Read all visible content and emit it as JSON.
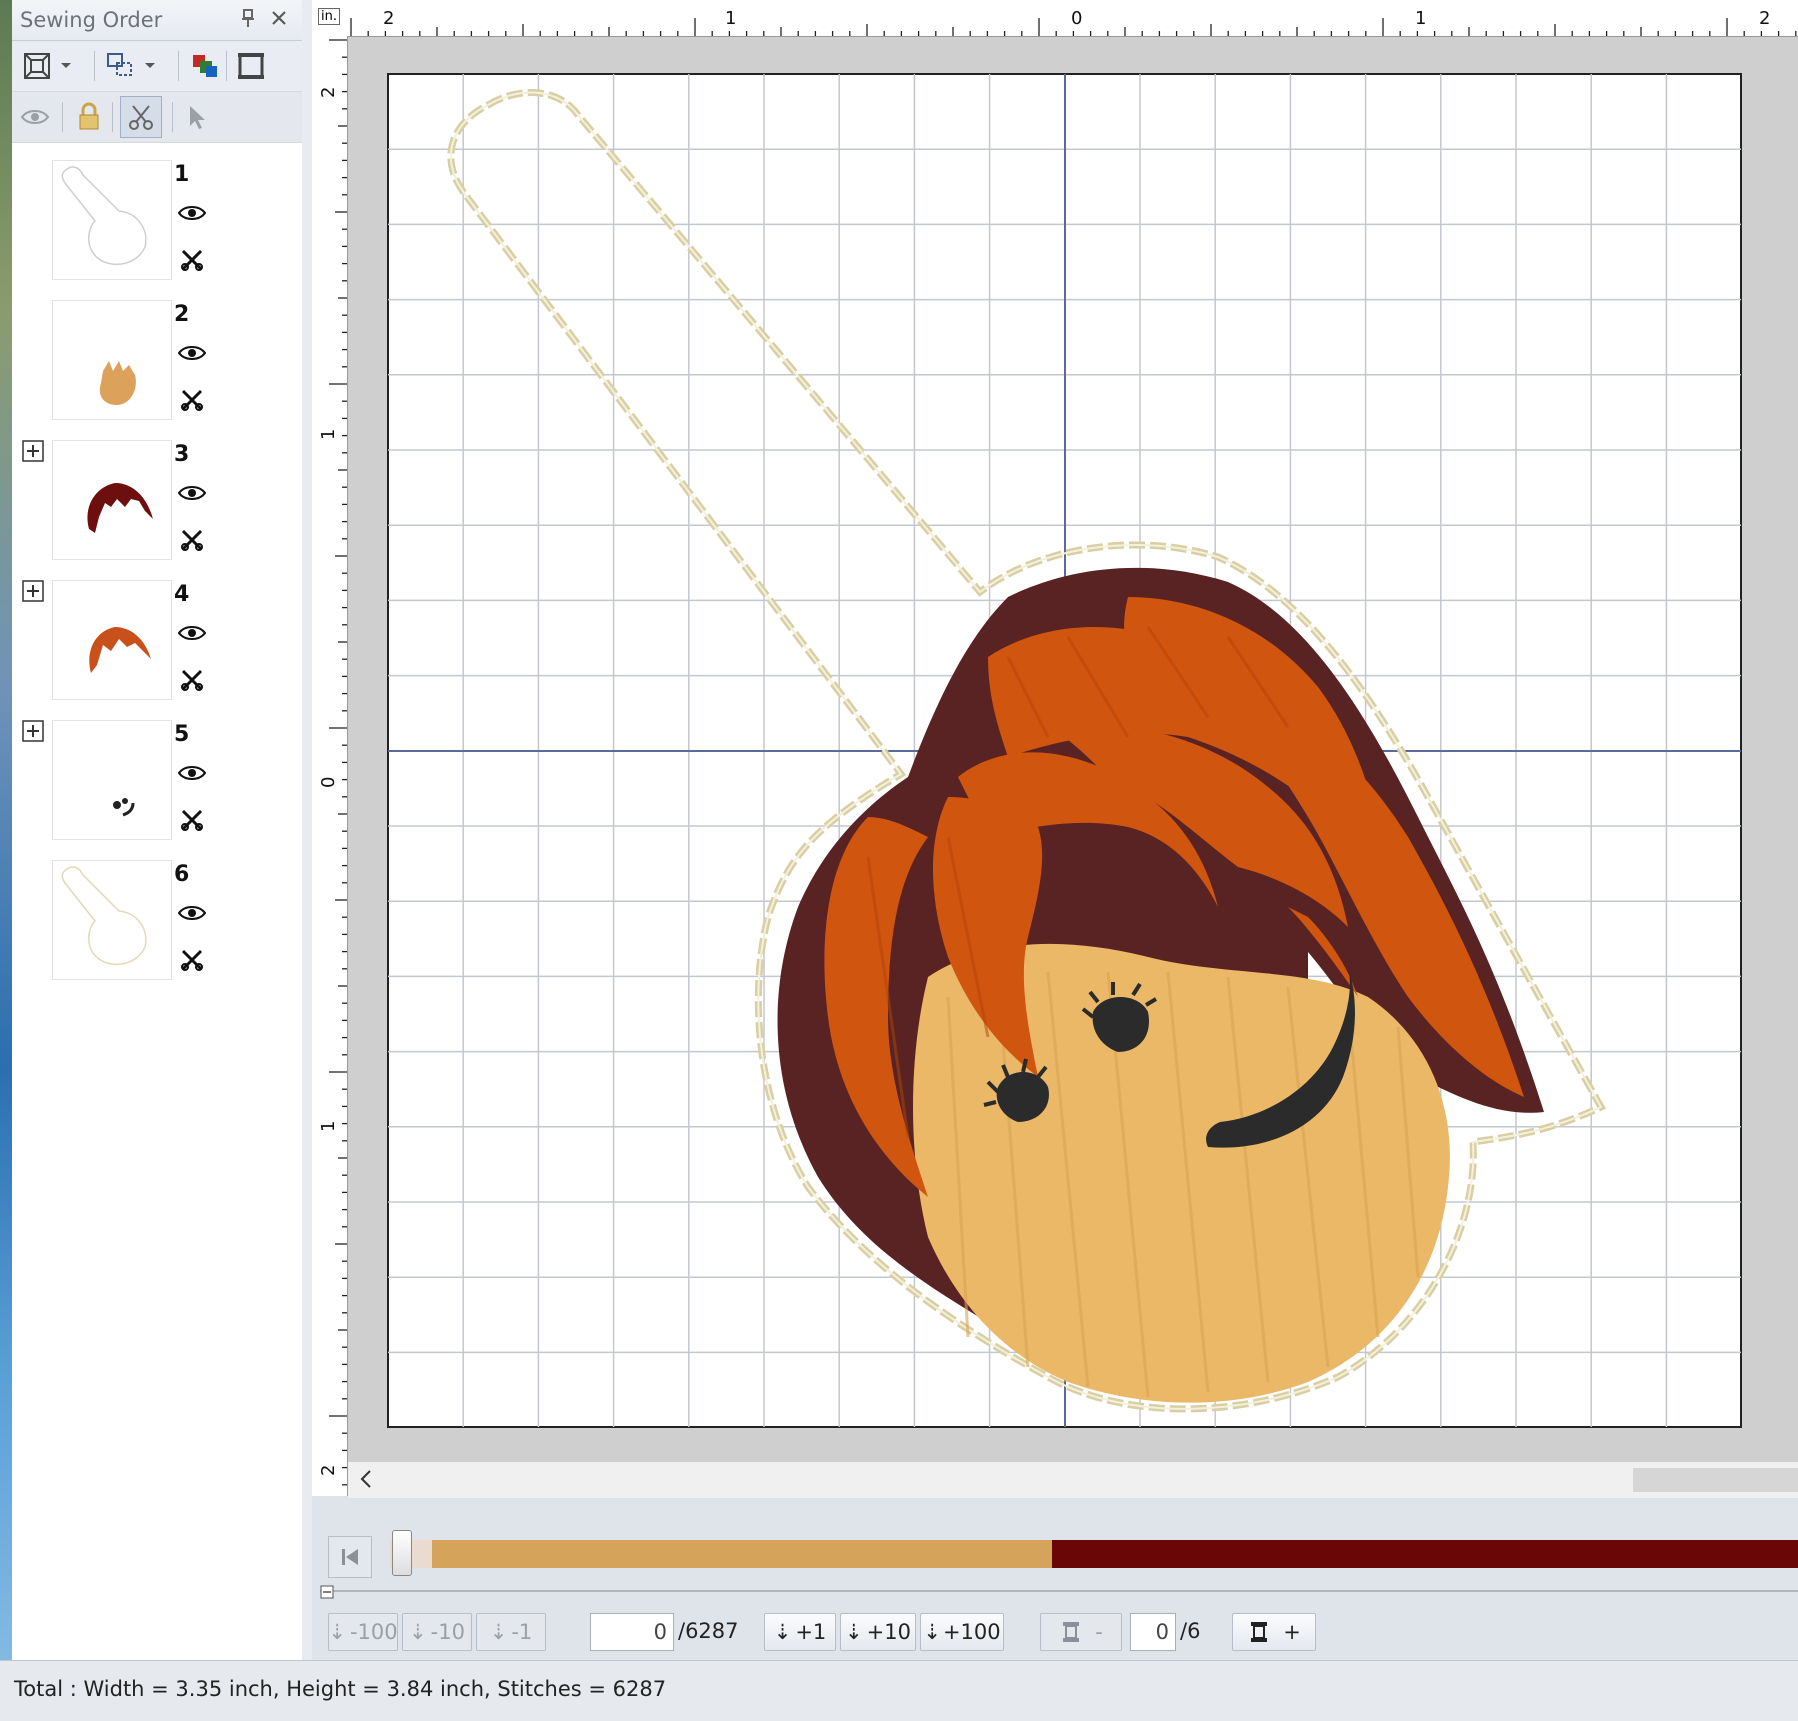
{
  "panel": {
    "title": "Sewing Order",
    "pin_icon": "pin-icon",
    "close_icon": "close-icon"
  },
  "layers": [
    {
      "number": "1",
      "color": "#d8d8d8",
      "shape": "outline",
      "expandable": false
    },
    {
      "number": "2",
      "color": "#e0a85c",
      "shape": "face",
      "expandable": false
    },
    {
      "number": "3",
      "color": "#6e0f0f",
      "shape": "hair",
      "expandable": true
    },
    {
      "number": "4",
      "color": "#c8501a",
      "shape": "hair",
      "expandable": true
    },
    {
      "number": "5",
      "color": "#222222",
      "shape": "eyes",
      "expandable": true
    },
    {
      "number": "6",
      "color": "#e6dcb8",
      "shape": "outline",
      "expandable": false
    }
  ],
  "ruler": {
    "unit": "in.",
    "top_labels": [
      "2",
      "1",
      "0",
      "1",
      "2"
    ],
    "left_labels": [
      "2",
      "1",
      "0",
      "1",
      "2"
    ]
  },
  "stitch_bar": {
    "segments": [
      {
        "color": "#eadbd0",
        "fraction": 0.03
      },
      {
        "color": "#d6a35a",
        "fraction": 0.44
      },
      {
        "color": "#6a0606",
        "fraction": 0.53
      }
    ]
  },
  "controls": {
    "minus100": "-100",
    "minus10": "-10",
    "minus1": "-1",
    "stitch_current": "0",
    "stitch_total": "/6287",
    "plus1": "+1",
    "plus10": "+10",
    "plus100": "+100",
    "color_minus": "-",
    "color_current": "0",
    "color_total": "/6",
    "color_plus": "+"
  },
  "status": {
    "text": "Total : Width = 3.35 inch, Height = 3.84 inch, Stitches = 6287"
  },
  "colors": {
    "hair_dark": "#5a2323",
    "hair_orange": "#d0550f",
    "skin": "#ebb867",
    "eyes": "#2b2b2b",
    "outline": "#d8cfa4"
  }
}
